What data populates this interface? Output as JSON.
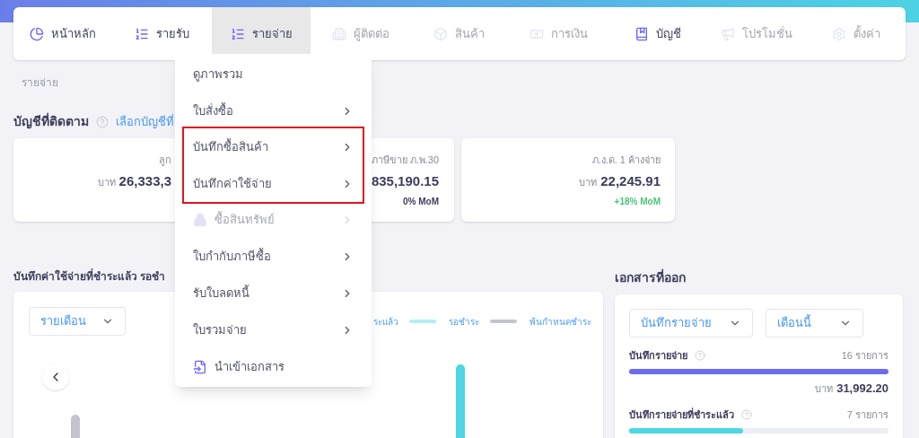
{
  "nav": [
    {
      "label": "หน้าหลัก",
      "selected": false,
      "disabled": false
    },
    {
      "label": "รายรับ",
      "selected": false,
      "disabled": false
    },
    {
      "label": "รายจ่าย",
      "selected": true,
      "disabled": false
    },
    {
      "label": "ผู้ติดต่อ",
      "selected": false,
      "disabled": true
    },
    {
      "label": "สินค้า",
      "selected": false,
      "disabled": true
    },
    {
      "label": "การเงิน",
      "selected": false,
      "disabled": true
    },
    {
      "label": "บัญชี",
      "selected": false,
      "disabled": false
    },
    {
      "label": "โปรโมชั่น",
      "selected": false,
      "disabled": true
    },
    {
      "label": "ตั้งค่า",
      "selected": false,
      "disabled": true
    }
  ],
  "breadcrumb": "รายจ่าย",
  "watched_accounts": {
    "title": "บัญชีที่ติดตาม",
    "link": "เลือกบัญชีที่",
    "cards": [
      {
        "label": "ลูก",
        "currency": "บาท",
        "amount": "26,333,3"
      },
      {
        "label": "ภาษีขาย ภ.พ.30",
        "amount": "835,190.15",
        "change": "0% MoM",
        "positive": false
      },
      {
        "label": "ภ.ง.ด. 1 ค้างจ่าย",
        "currency": "บาท",
        "amount": "22,245.91",
        "change": "+18% MoM",
        "positive": true
      }
    ]
  },
  "expenses_panel": {
    "title": "บันทึกค่าใช้จ่ายที่ชำระแล้ว รอชำ",
    "period_select": "รายเดือน",
    "legend": [
      {
        "label": "ระแล้ว"
      },
      {
        "label": "รอชำระ",
        "color": "#b2eef5"
      },
      {
        "label": "พ้นกำหนดชำระ",
        "color": "#c4c4d0"
      }
    ]
  },
  "documents_panel": {
    "title": "เอกสารที่ออก",
    "type_select": "บันทึกรายจ่าย",
    "period_select": "เดือนนี้",
    "rows": [
      {
        "label": "บันทึกรายจ่าย",
        "count": "16 รายการ",
        "level": 1,
        "color": "#6c6cf0",
        "currency": "บาท",
        "amount": "31,992.20"
      },
      {
        "label": "บันทึกรายจ่ายที่ชำระแล้ว",
        "count": "7 รายการ",
        "level": 0.44,
        "color": "#4dd6e4"
      }
    ]
  },
  "menu": [
    {
      "label": "ดูภาพรวม",
      "submenu": false,
      "disabled": false,
      "highlighted": false,
      "kind": "plain"
    },
    {
      "label": "ใบสั่งซื้อ",
      "submenu": true,
      "disabled": false,
      "highlighted": false,
      "kind": "plain"
    },
    {
      "label": "บันทึกซื้อสินค้า",
      "submenu": true,
      "disabled": false,
      "highlighted": true,
      "kind": "plain"
    },
    {
      "label": "บันทึกค่าใช้จ่าย",
      "submenu": true,
      "disabled": false,
      "highlighted": true,
      "kind": "plain"
    },
    {
      "label": "ซื้อสินทรัพย์",
      "submenu": true,
      "disabled": true,
      "highlighted": false,
      "kind": "locked"
    },
    {
      "label": "ใบกำกับภาษีซื้อ",
      "submenu": true,
      "disabled": false,
      "highlighted": false,
      "kind": "plain"
    },
    {
      "label": "รับใบลดหนี้",
      "submenu": true,
      "disabled": false,
      "highlighted": false,
      "kind": "plain"
    },
    {
      "label": "ใบรวมจ่าย",
      "submenu": true,
      "disabled": false,
      "highlighted": false,
      "kind": "plain"
    },
    {
      "label": "นำเข้าเอกสาร",
      "submenu": false,
      "disabled": false,
      "highlighted": false,
      "kind": "import"
    }
  ]
}
